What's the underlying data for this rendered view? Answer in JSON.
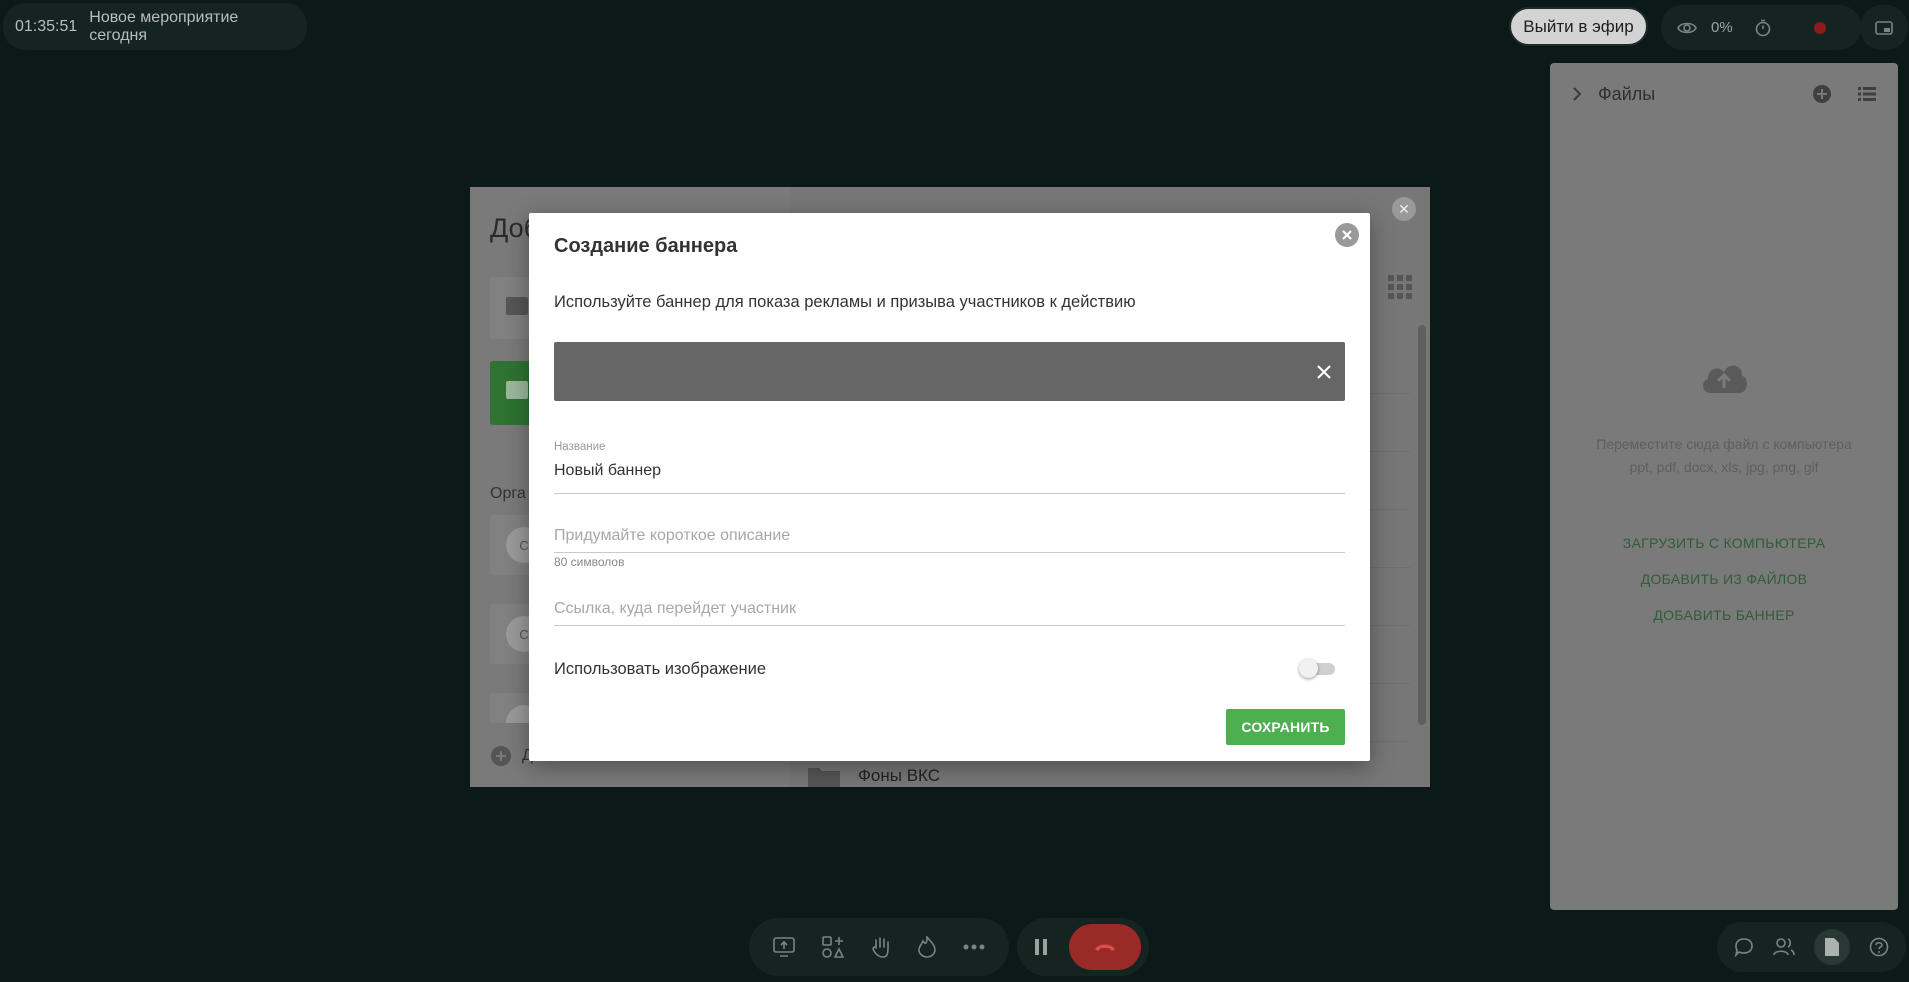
{
  "top_bar": {
    "timer": "01:35:51",
    "event_title": "Новое мероприятие сегодня",
    "live_button": "Выйти в эфир",
    "viewers_percent": "0%"
  },
  "files_panel": {
    "title": "Файлы",
    "drop_hint_line1": "Переместите сюда файл с компьютера",
    "drop_hint_line2": "ppt, pdf, docx, xls, jpg, png, gif",
    "upload_link": "ЗАГРУЗИТЬ С КОМПЬЮТЕРА",
    "add_from_files_link": "ДОБАВИТЬ ИЗ ФАЙЛОВ",
    "add_banner_link": "ДОБАВИТЬ БАННЕР"
  },
  "bg_dialog": {
    "title_partial": "Доб",
    "organizers_partial": "Орга",
    "avatar_letter": "С",
    "add_partial": "Д",
    "folder_name": "Фоны ВКС"
  },
  "modal": {
    "title": "Создание баннера",
    "description": "Используйте баннер для показа рекламы и призыва участников к действию",
    "name_label": "Название",
    "name_value": "Новый баннер",
    "short_desc_placeholder": "Придумайте короткое описание",
    "short_desc_counter": "80 символов",
    "link_placeholder": "Ссылка, куда перейдет участник",
    "use_image_label": "Использовать изображение",
    "use_image_enabled": false,
    "save_button": "СОХРАНИТЬ"
  },
  "colors": {
    "background": "#0b1a18",
    "accent_green": "#4caf50",
    "end_call_red": "#9a2a25",
    "record_dot": "#8b1a1a"
  },
  "icons": {
    "top": [
      "eye-icon",
      "stopwatch-icon",
      "record-icon",
      "pip-icon"
    ],
    "files_panel": [
      "chevron-right-icon",
      "add-circle-icon",
      "list-view-icon",
      "cloud-upload-icon"
    ],
    "bottom_left": [
      "screen-share-icon",
      "apps-icon",
      "raise-hand-icon",
      "reaction-icon",
      "more-icon"
    ],
    "bottom_mid": [
      "pause-icon",
      "end-call-icon"
    ],
    "bottom_right": [
      "chat-icon",
      "participants-icon",
      "files-icon",
      "qa-icon"
    ]
  }
}
